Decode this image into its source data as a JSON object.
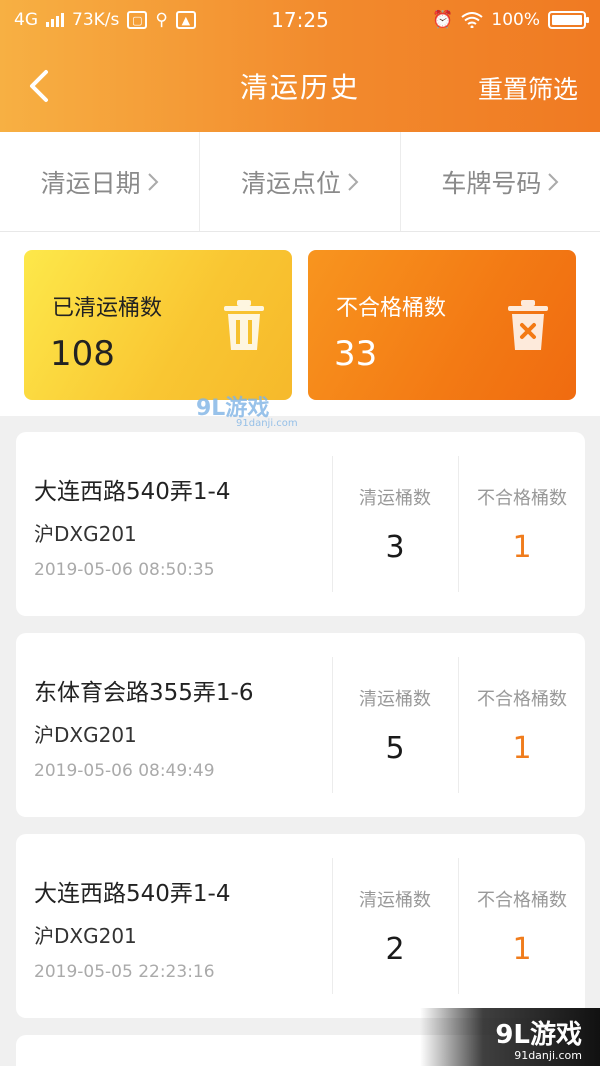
{
  "status_bar": {
    "network": "4G",
    "speed": "73K/s",
    "time": "17:25",
    "battery": "100%"
  },
  "nav": {
    "title": "清运历史",
    "reset_label": "重置筛选"
  },
  "filters": [
    {
      "label": "清运日期"
    },
    {
      "label": "清运点位"
    },
    {
      "label": "车牌号码"
    }
  ],
  "stats": {
    "cleared": {
      "label": "已清运桶数",
      "value": "108",
      "icon": "trash-bin-icon"
    },
    "unqualified": {
      "label": "不合格桶数",
      "value": "33",
      "icon": "trash-bin-x-icon"
    }
  },
  "watermark": {
    "main": "9L游戏",
    "sub": "91danji.com"
  },
  "records_header": {
    "cleared": "清运桶数",
    "unqualified": "不合格桶数"
  },
  "records": [
    {
      "address": "大连西路540弄1-4",
      "plate": "沪DXG201",
      "time": "2019-05-06 08:50:35",
      "cleared": "3",
      "unqualified": "1"
    },
    {
      "address": "东体育会路355弄1-6",
      "plate": "沪DXG201",
      "time": "2019-05-06 08:49:49",
      "cleared": "5",
      "unqualified": "1"
    },
    {
      "address": "大连西路540弄1-4",
      "plate": "沪DXG201",
      "time": "2019-05-05 22:23:16",
      "cleared": "2",
      "unqualified": "1"
    }
  ],
  "brand_badge": {
    "main": "9L游戏",
    "sub": "91danji.com"
  },
  "colors": {
    "header": "#f28a2d",
    "accent": "#f07c1c",
    "yellow_card": "#f9c632"
  }
}
